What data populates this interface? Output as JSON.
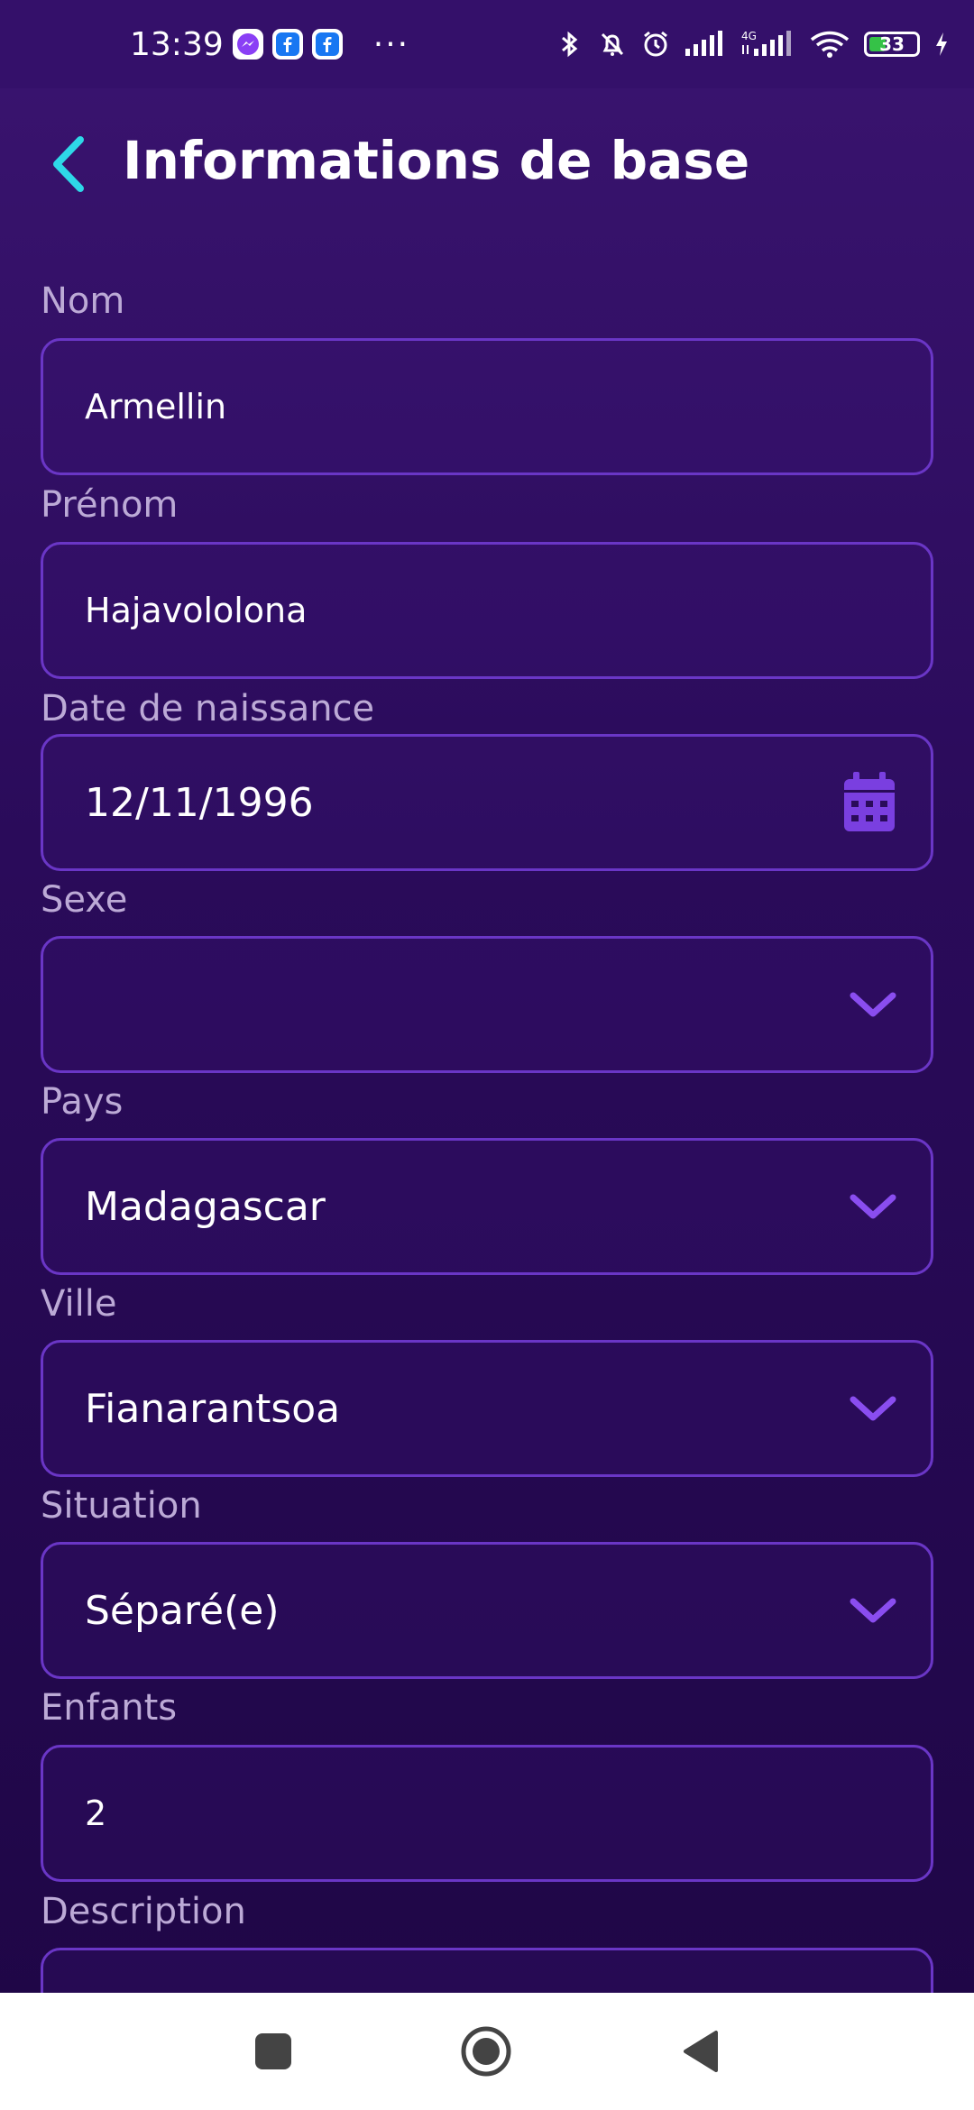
{
  "status_bar": {
    "time": "13:39",
    "battery": "33",
    "more": "···",
    "icons": [
      "messenger-icon",
      "facebook-icon",
      "facebook-icon",
      "bluetooth-icon",
      "bell-muted-icon",
      "alarm-icon",
      "signal-icon",
      "signal-4g-icon",
      "wifi-icon",
      "battery-icon",
      "charging-icon"
    ]
  },
  "header": {
    "title": "Informations de base",
    "back_icon": "chevron-left-icon"
  },
  "form": {
    "nom": {
      "label": "Nom",
      "value": "Armellin"
    },
    "prenom": {
      "label": "Prénom",
      "value": "Hajavololona"
    },
    "date_naissance": {
      "label": "Date de naissance",
      "value": "12/11/1996",
      "icon": "calendar-icon"
    },
    "sexe": {
      "label": "Sexe",
      "value": "",
      "icon": "chevron-down-icon"
    },
    "pays": {
      "label": "Pays",
      "value": "Madagascar",
      "icon": "chevron-down-icon"
    },
    "ville": {
      "label": "Ville",
      "value": "Fianarantsoa",
      "icon": "chevron-down-icon"
    },
    "situation": {
      "label": "Situation",
      "value": "Séparé(e)",
      "icon": "chevron-down-icon"
    },
    "enfants": {
      "label": "Enfants",
      "value": "2"
    },
    "description": {
      "label": "Description",
      "value": ""
    }
  },
  "colors": {
    "accent": "#8a4df0",
    "back_arrow": "#2ed8e8",
    "label": "#bcaad6",
    "border": "#6a36c6",
    "background_top": "#3a1470",
    "background_bottom": "#1e0645"
  },
  "nav_bar": {
    "icons": [
      "recents-square-icon",
      "home-circle-icon",
      "back-triangle-icon"
    ]
  }
}
